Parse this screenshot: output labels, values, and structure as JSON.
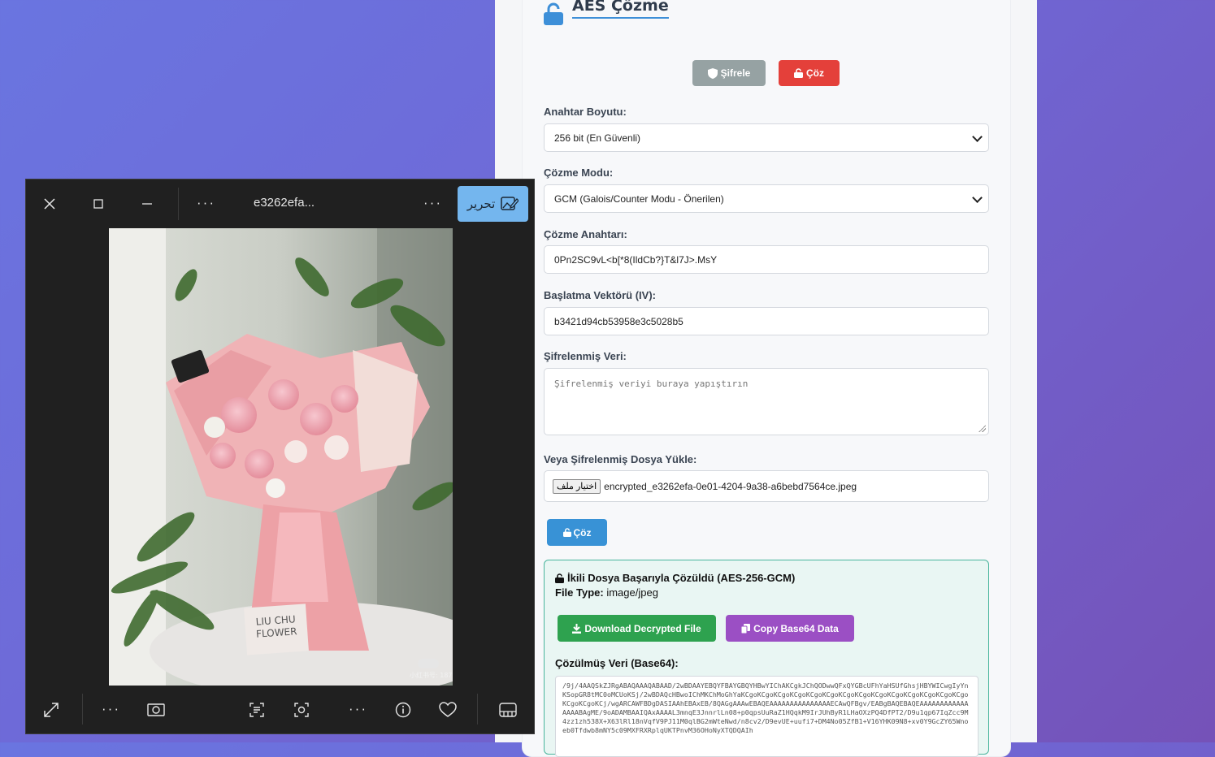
{
  "app": {
    "title": "AES Çözme",
    "tabs": {
      "encrypt": "Şifrele",
      "decrypt": "Çöz"
    }
  },
  "form": {
    "key_size_label": "Anahtar Boyutu:",
    "key_size_value": "256 bit (En Güvenli)",
    "mode_label": "Çözme Modu:",
    "mode_value": "GCM (Galois/Counter Modu - Önerilen)",
    "key_label": "Çözme Anahtarı:",
    "key_value": "0Pn2SC9vL<b[*8(IldCb?}T&l7J>.MsY",
    "iv_label": "Başlatma Vektörü (IV):",
    "iv_value": "b3421d94cb53958e3c5028b5",
    "cipher_label": "Şifrelenmiş Veri:",
    "cipher_placeholder": "Şifrelenmiş veriyi buraya yapıştırın",
    "file_label": "Veya Şifrelenmiş Dosya Yükle:",
    "file_button": "اختيار ملف",
    "file_name": "encrypted_e3262efa-0e01-4204-9a38-a6bebd7564ce.jpeg",
    "decrypt_button": "Çöz"
  },
  "result": {
    "title": "İkili Dosya Başarıyla Çözüldü (AES-256-GCM)",
    "type_label": "File Type:",
    "type_value": "image/jpeg",
    "download_button": "Download Decrypted File",
    "copy_button": "Copy Base64 Data",
    "data_label": "Çözülmüş Veri (Base64):",
    "data_value": "/9j/4AAQSkZJRgABAQAAAQABAAD/2wBDAAYEBQYFBAYGBQYHBwYIChAKCgkJChQODwwQFxQYGBcUFhYaHSUfGhsjHBYWICwgIyYnKSopGR8tMC0oMCUoKSj/2wBDAQcHBwoIChMKChMoGhYaKCgoKCgoKCgoKCgoKCgoKCgoKCgoKCgoKCgoKCgoKCgoKCgoKCgoKCgoKCgoKCgoKCj/wgARCAWFBDgDASIAAhEBAxEB/8QAGgAAAwEBAQEAAAAAAAAAAAAAAAECAwQFBgv/EABgBAQEBAQEAAAAAAAAAAAAAAAABAgME/9oADAMBAAIQAxAAAAL3mnqE3JnnrlLn08+p0qpsUuRaZ1HQqkM9IrJUhByR1LHaOXzPQ4DfPT2/D9u1qp67IqZcc9M4zz1zh538X+X63lRl18nVqfV9PJ11M0qlBG2mWteNwd/n8cv2/D9evUE+uufi7+DM4No05ZfB1+V16YHK09N8+xv0Y9GcZY65Wnoeb0Tfdwb8mNY5c09MXFRXRplqUKTPnvM36OHoNyXTQDQAIh"
  },
  "viewer": {
    "title": "e3262efa...",
    "edit_label": "تحرير",
    "photo_card": "LIU CHU\nFLOWER",
    "photo_watermark": "小红书号: 187389256"
  },
  "colors": {
    "accent_blue": "#3892d6",
    "danger_red": "#e4403a",
    "success_green": "#2ea24f",
    "purple": "#9b4fc4"
  }
}
